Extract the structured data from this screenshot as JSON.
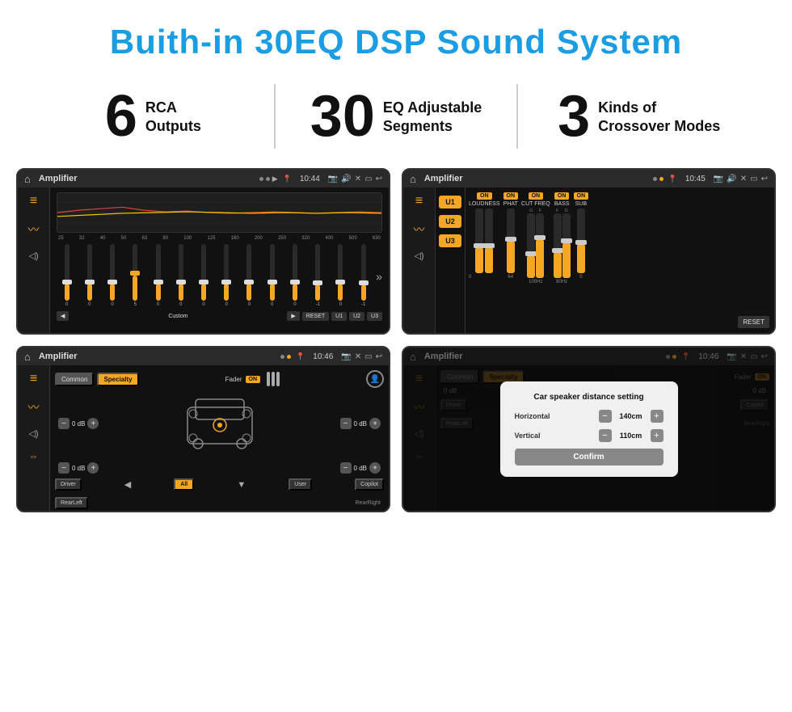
{
  "header": {
    "title": "Buith-in 30EQ DSP Sound System"
  },
  "stats": [
    {
      "number": "6",
      "line1": "RCA",
      "line2": "Outputs"
    },
    {
      "number": "30",
      "line1": "EQ Adjustable",
      "line2": "Segments"
    },
    {
      "number": "3",
      "line1": "Kinds of",
      "line2": "Crossover Modes"
    }
  ],
  "screens": [
    {
      "id": "screen1",
      "title": "Amplifier",
      "time": "10:44",
      "description": "EQ Screen with 13 bands"
    },
    {
      "id": "screen2",
      "title": "Amplifier",
      "time": "10:45",
      "description": "Amplifier controls U1 U2 U3"
    },
    {
      "id": "screen3",
      "title": "Amplifier",
      "time": "10:46",
      "description": "Fader/Speaker layout"
    },
    {
      "id": "screen4",
      "title": "Amplifier",
      "time": "10:46",
      "description": "Car speaker distance setting dialog"
    }
  ],
  "eq": {
    "freqs": [
      "25",
      "32",
      "40",
      "50",
      "63",
      "80",
      "100",
      "125",
      "160",
      "200",
      "250",
      "320",
      "400",
      "500",
      "630"
    ],
    "values": [
      "0",
      "0",
      "0",
      "5",
      "0",
      "0",
      "0",
      "0",
      "0",
      "0",
      "0",
      "0",
      "-1",
      "0",
      "-1"
    ],
    "presets": [
      "Custom",
      "RESET",
      "U1",
      "U2",
      "U3"
    ]
  },
  "dialog": {
    "title": "Car speaker distance setting",
    "horizontal_label": "Horizontal",
    "horizontal_value": "140cm",
    "vertical_label": "Vertical",
    "vertical_value": "110cm",
    "confirm_label": "Confirm"
  },
  "labels": {
    "loudness": "LOUDNESS",
    "phat": "PHAT",
    "cut_freq": "CUT FREQ",
    "bass": "BASS",
    "sub": "SUB",
    "u1": "U1",
    "u2": "U2",
    "u3": "U3",
    "on": "ON",
    "reset": "RESET",
    "common": "Common",
    "specialty": "Specialty",
    "fader": "Fader",
    "driver": "Driver",
    "copilot": "Copilot",
    "rear_left": "RearLeft",
    "rear_right": "RearRight",
    "all": "All",
    "user": "User",
    "db_zero": "0 dB"
  }
}
